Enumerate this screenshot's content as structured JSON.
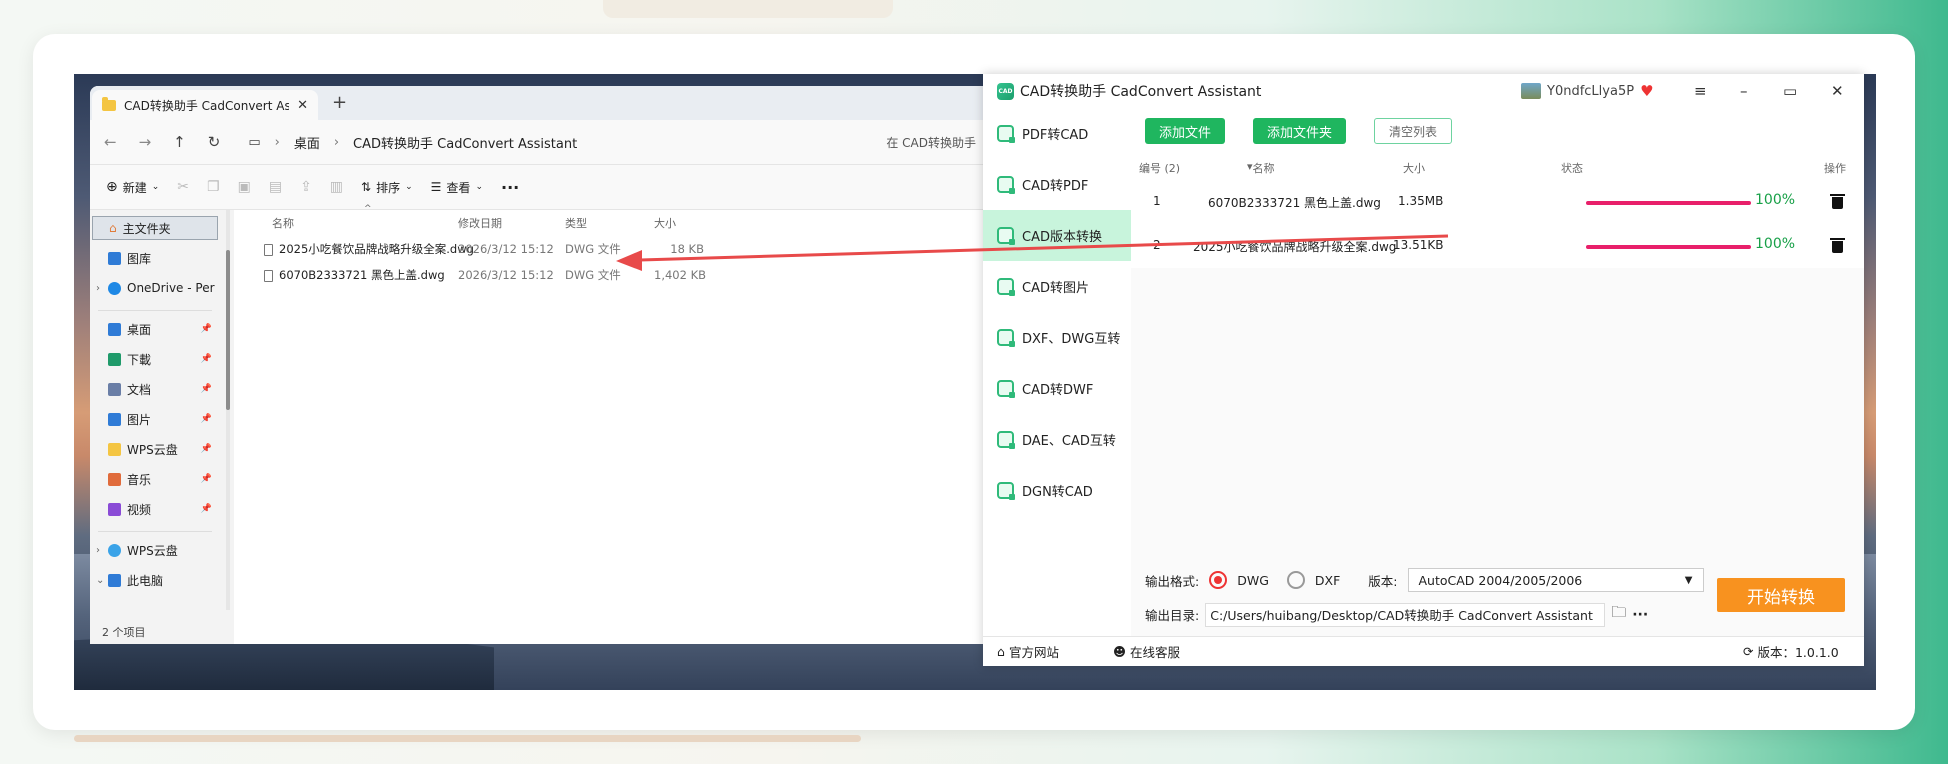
{
  "explorer": {
    "tab_title": "CAD转换助手 CadConvert Assi",
    "breadcrumb": [
      "桌面",
      "CAD转换助手 CadConvert Assistant"
    ],
    "search_text": "在 CAD转换助手",
    "toolbar": {
      "new": "新建",
      "sort": "排序",
      "view": "查看"
    },
    "sidebar": {
      "home": "主文件夹",
      "gallery": "图库",
      "onedrive": "OneDrive - Per",
      "pinned": [
        {
          "label": "桌面",
          "icon": "desktop-icon",
          "color": "#2f7bd6"
        },
        {
          "label": "下載",
          "icon": "download-icon",
          "color": "#1f9a6a"
        },
        {
          "label": "文档",
          "icon": "document-icon",
          "color": "#6a7ea6"
        },
        {
          "label": "图片",
          "icon": "picture-icon",
          "color": "#2f7bd6"
        },
        {
          "label": "WPS云盘",
          "icon": "folder-icon",
          "color": "#f4c542"
        },
        {
          "label": "音乐",
          "icon": "music-icon",
          "color": "#e06b3b"
        },
        {
          "label": "视频",
          "icon": "video-icon",
          "color": "#8a4bd6"
        }
      ],
      "wps": "WPS云盘",
      "pc": "此电脑"
    },
    "columns": {
      "name": "名称",
      "date": "修改日期",
      "type": "类型",
      "size": "大小"
    },
    "files": [
      {
        "name": "2025小吃餐饮品牌战略升级全案.dwg",
        "date": "2026/3/12 15:12",
        "type": "DWG 文件",
        "size": "18 KB"
      },
      {
        "name": "6070B2333721 黑色上盖.dwg",
        "date": "2026/3/12 15:12",
        "type": "DWG 文件",
        "size": "1,402 KB"
      }
    ],
    "status": "2 个项目"
  },
  "cad": {
    "title": "CAD转换助手 CadConvert Assistant",
    "user": "Y0ndfcLlya5P",
    "sidebar": [
      "PDF转CAD",
      "CAD转PDF",
      "CAD版本转换",
      "CAD转图片",
      "DXF、DWG互转",
      "CAD转DWF",
      "DAE、CAD互转",
      "DGN转CAD"
    ],
    "active_index": 2,
    "buttons": {
      "add_file": "添加文件",
      "add_folder": "添加文件夹",
      "clear": "清空列表"
    },
    "columns": {
      "num": "编号 (2)",
      "name": "名称",
      "size": "大小",
      "status": "状态",
      "op": "操作"
    },
    "rows": [
      {
        "num": "1",
        "name": "6070B2333721 黑色上盖.dwg",
        "size": "1.35MB",
        "progress": "100%"
      },
      {
        "num": "2",
        "name": "2025小吃餐饮品牌战略升级全案.dwg",
        "size": "13.51KB",
        "progress": "100%"
      }
    ],
    "output": {
      "format_label": "输出格式:",
      "dwg": "DWG",
      "dxf": "DXF",
      "version_label": "版本:",
      "version": "AutoCAD 2004/2005/2006",
      "dir_label": "输出目录:",
      "dir": "C:/Users/huibang/Desktop/CAD转换助手 CadConvert Assistant"
    },
    "start": "开始转换",
    "footer": {
      "site": "官方网站",
      "service": "在线客服",
      "version": "版本：1.0.1.0"
    },
    "colors": {
      "accent": "#1fb65f",
      "progress": "#e8206a",
      "start": "#f8921f"
    }
  }
}
